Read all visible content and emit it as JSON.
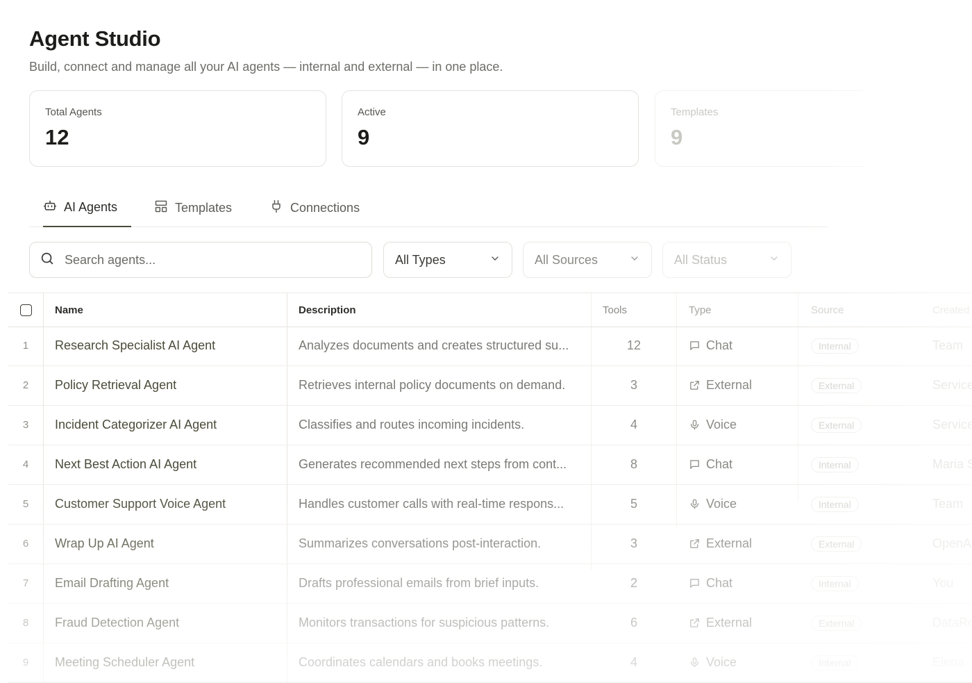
{
  "header": {
    "title": "Agent Studio",
    "subtitle": "Build, connect and manage all your AI agents — internal and external — in one place."
  },
  "stats": [
    {
      "label": "Total Agents",
      "value": "12"
    },
    {
      "label": "Active",
      "value": "9"
    },
    {
      "label": "Templates",
      "value": "9"
    }
  ],
  "tabs": [
    {
      "label": "AI Agents",
      "icon": "robot-icon",
      "active": true
    },
    {
      "label": "Templates",
      "icon": "layout-icon",
      "active": false
    },
    {
      "label": "Connections",
      "icon": "plug-icon",
      "active": false
    }
  ],
  "filters": {
    "search_placeholder": "Search agents...",
    "type": "All Types",
    "source": "All Sources",
    "status": "All Status"
  },
  "table": {
    "columns": [
      "Name",
      "Description",
      "Tools",
      "Type",
      "Source",
      "Created"
    ],
    "rows": [
      {
        "num": "1",
        "name": "Research Specialist AI Agent",
        "desc": "Analyzes documents and creates structured su...",
        "tools": "12",
        "type": "Chat",
        "type_icon": "chat-icon",
        "source": "Internal",
        "created": "Team"
      },
      {
        "num": "2",
        "name": "Policy Retrieval Agent",
        "desc": "Retrieves internal policy documents on demand.",
        "tools": "3",
        "type": "External",
        "type_icon": "external-link-icon",
        "source": "External",
        "created": "Service"
      },
      {
        "num": "3",
        "name": "Incident Categorizer AI Agent",
        "desc": "Classifies and routes incoming incidents.",
        "tools": "4",
        "type": "Voice",
        "type_icon": "mic-icon",
        "source": "External",
        "created": "Service"
      },
      {
        "num": "4",
        "name": "Next Best Action AI Agent",
        "desc": "Generates recommended next steps from cont...",
        "tools": "8",
        "type": "Chat",
        "type_icon": "chat-icon",
        "source": "Internal",
        "created": "Maria S"
      },
      {
        "num": "5",
        "name": "Customer Support Voice Agent",
        "desc": "Handles customer calls with real-time respons...",
        "tools": "5",
        "type": "Voice",
        "type_icon": "mic-icon",
        "source": "Internal",
        "created": "Team"
      },
      {
        "num": "6",
        "name": "Wrap Up AI Agent",
        "desc": "Summarizes conversations post-interaction.",
        "tools": "3",
        "type": "External",
        "type_icon": "external-link-icon",
        "source": "External",
        "created": "OpenAI"
      },
      {
        "num": "7",
        "name": "Email Drafting Agent",
        "desc": "Drafts professional emails from brief inputs.",
        "tools": "2",
        "type": "Chat",
        "type_icon": "chat-icon",
        "source": "Internal",
        "created": "You"
      },
      {
        "num": "8",
        "name": "Fraud Detection Agent",
        "desc": "Monitors transactions for suspicious patterns.",
        "tools": "6",
        "type": "External",
        "type_icon": "external-link-icon",
        "source": "External",
        "created": "DataRo"
      },
      {
        "num": "9",
        "name": "Meeting Scheduler Agent",
        "desc": "Coordinates calendars and books meetings.",
        "tools": "4",
        "type": "Voice",
        "type_icon": "mic-icon",
        "source": "Internal",
        "created": "Elena"
      }
    ]
  }
}
